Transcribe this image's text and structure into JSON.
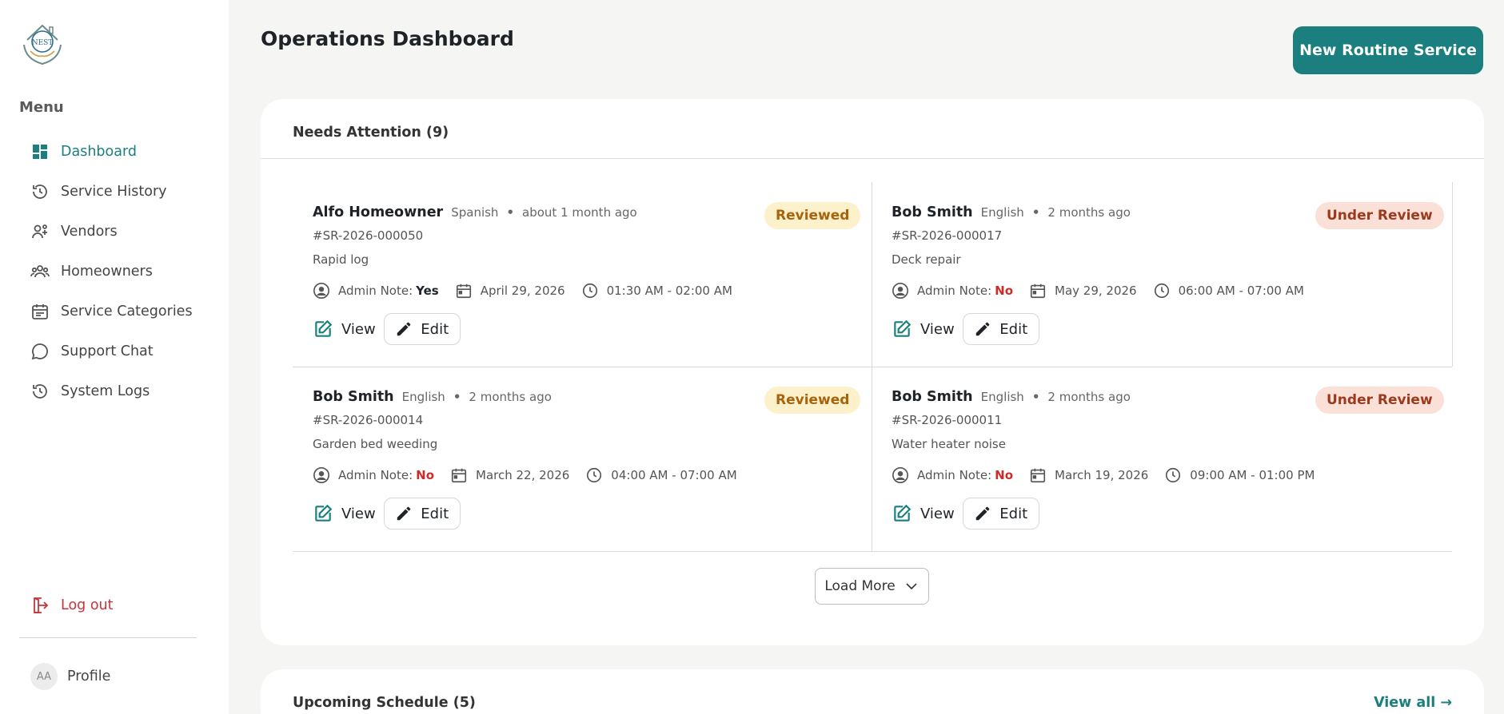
{
  "sidebar": {
    "menu_heading": "Menu",
    "items": [
      {
        "label": "Dashboard",
        "icon": "dashboard-icon",
        "active": true
      },
      {
        "label": "Service History",
        "icon": "history-icon"
      },
      {
        "label": "Vendors",
        "icon": "vendor-icon"
      },
      {
        "label": "Homeowners",
        "icon": "people-icon"
      },
      {
        "label": "Service Categories",
        "icon": "calendar-list-icon"
      },
      {
        "label": "Support Chat",
        "icon": "chat-icon"
      },
      {
        "label": "System Logs",
        "icon": "history-icon"
      }
    ],
    "logout_label": "Log out",
    "profile": {
      "initials": "AA",
      "label": "Profile"
    }
  },
  "header": {
    "title": "Operations Dashboard",
    "primary_button": "New Routine Service"
  },
  "needs_attention": {
    "title": "Needs Attention (9)",
    "admin_note_label": "Admin Note:",
    "view_label": "View",
    "edit_label": "Edit",
    "cards": [
      {
        "name": "Alfo Homeowner",
        "language": "Spanish",
        "ago": "about 1 month ago",
        "id": "#SR-2026-000050",
        "description": "Rapid log",
        "admin_note": "Yes",
        "date": "April 29, 2026",
        "time": "01:30 AM - 02:00 AM",
        "status": "Reviewed"
      },
      {
        "name": "Bob Smith",
        "language": "English",
        "ago": "2 months ago",
        "id": "#SR-2026-000017",
        "description": "Deck repair",
        "admin_note": "No",
        "date": "May 29, 2026",
        "time": "06:00 AM - 07:00 AM",
        "status": "Under Review"
      },
      {
        "name": "Bob Smith",
        "language": "English",
        "ago": "2 months ago",
        "id": "#SR-2026-000014",
        "description": "Garden bed weeding",
        "admin_note": "No",
        "date": "March 22, 2026",
        "time": "04:00 AM - 07:00 AM",
        "status": "Reviewed"
      },
      {
        "name": "Bob Smith",
        "language": "English",
        "ago": "2 months ago",
        "id": "#SR-2026-000011",
        "description": "Water heater noise",
        "admin_note": "No",
        "date": "March 19, 2026",
        "time": "09:00 AM - 01:00 PM",
        "status": "Under Review"
      }
    ],
    "load_more_label": "Load More"
  },
  "upcoming": {
    "title": "Upcoming Schedule (5)",
    "view_all_label": "View all →"
  },
  "colors": {
    "accent": "#1a7f7e",
    "danger": "#c8333a",
    "reviewed_bg": "#fdf1cb",
    "under_review_bg": "#fbe0d7"
  }
}
